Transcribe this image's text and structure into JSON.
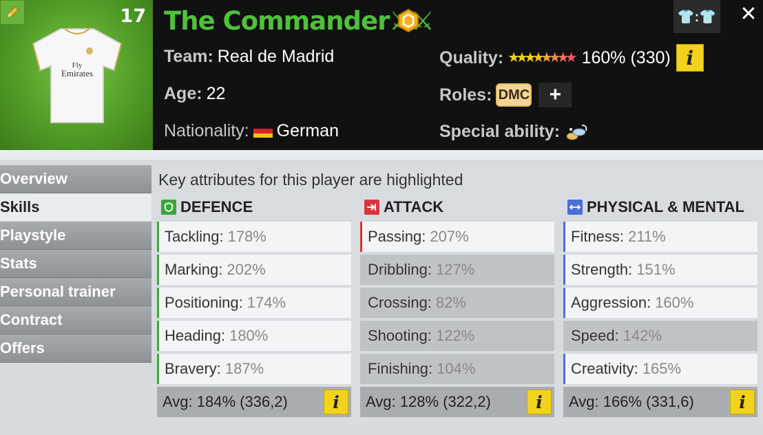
{
  "player": {
    "number": "17",
    "name": "The Commander",
    "name_suffix": "⚔⚔",
    "shirt_sponsor_line1": "Fly",
    "shirt_sponsor_line2": "Emirates",
    "team_label": "Team:",
    "team": "Real de Madrid",
    "age_label": "Age:",
    "age": "22",
    "nationality_label": "Nationality:",
    "nationality": "German",
    "quality_label": "Quality:",
    "quality_value": "160% (330)",
    "quality_stars": [
      {
        "color": "#f0d01a"
      },
      {
        "color": "#f0d01a"
      },
      {
        "color": "#f0d01a"
      },
      {
        "color": "#f0c020"
      },
      {
        "color": "#f2a838"
      },
      {
        "color": "#f08a4a"
      },
      {
        "color": "#f07058"
      },
      {
        "color": "#f05a68"
      }
    ],
    "roles_label": "Roles:",
    "role": "DMC",
    "add_role": "+",
    "special_label": "Special ability:",
    "kit_label": "👕:👕",
    "close": "✕",
    "info": "i",
    "edit_icon": "pencil-icon"
  },
  "sidebar": {
    "items": [
      {
        "label": "Overview",
        "active": false
      },
      {
        "label": "Skills",
        "active": true
      },
      {
        "label": "Playstyle",
        "active": false
      },
      {
        "label": "Stats",
        "active": false
      },
      {
        "label": "Personal trainer",
        "active": false
      },
      {
        "label": "Contract",
        "active": false
      },
      {
        "label": "Offers",
        "active": false
      }
    ]
  },
  "skills": {
    "hint": "Key attributes for this player are highlighted",
    "columns": [
      {
        "title": "DEFENCE",
        "icon": "shield-icon",
        "color": "#3aa83a",
        "attrs": [
          {
            "name": "Tackling:",
            "value": "178%",
            "key": true
          },
          {
            "name": "Marking:",
            "value": "202%",
            "key": true
          },
          {
            "name": "Positioning:",
            "value": "174%",
            "key": true
          },
          {
            "name": "Heading:",
            "value": "180%",
            "key": true
          },
          {
            "name": "Bravery:",
            "value": "187%",
            "key": true
          }
        ],
        "avg": "Avg: 184% (336,2)"
      },
      {
        "title": "ATTACK",
        "icon": "attack-arrow-icon",
        "color": "#d8343c",
        "attrs": [
          {
            "name": "Passing:",
            "value": "207%",
            "key": true
          },
          {
            "name": "Dribbling:",
            "value": "127%",
            "key": false
          },
          {
            "name": "Crossing:",
            "value": "82%",
            "key": false
          },
          {
            "name": "Shooting:",
            "value": "122%",
            "key": false
          },
          {
            "name": "Finishing:",
            "value": "104%",
            "key": false
          }
        ],
        "avg": "Avg: 128% (322,2)"
      },
      {
        "title": "PHYSICAL & MENTAL",
        "icon": "arrows-horizontal-icon",
        "color": "#4a6fd6",
        "attrs": [
          {
            "name": "Fitness:",
            "value": "211%",
            "key": true
          },
          {
            "name": "Strength:",
            "value": "151%",
            "key": true
          },
          {
            "name": "Aggression:",
            "value": "160%",
            "key": true
          },
          {
            "name": "Speed:",
            "value": "142%",
            "key": false
          },
          {
            "name": "Creativity:",
            "value": "165%",
            "key": true
          }
        ],
        "avg": "Avg: 166% (331,6)"
      }
    ]
  }
}
